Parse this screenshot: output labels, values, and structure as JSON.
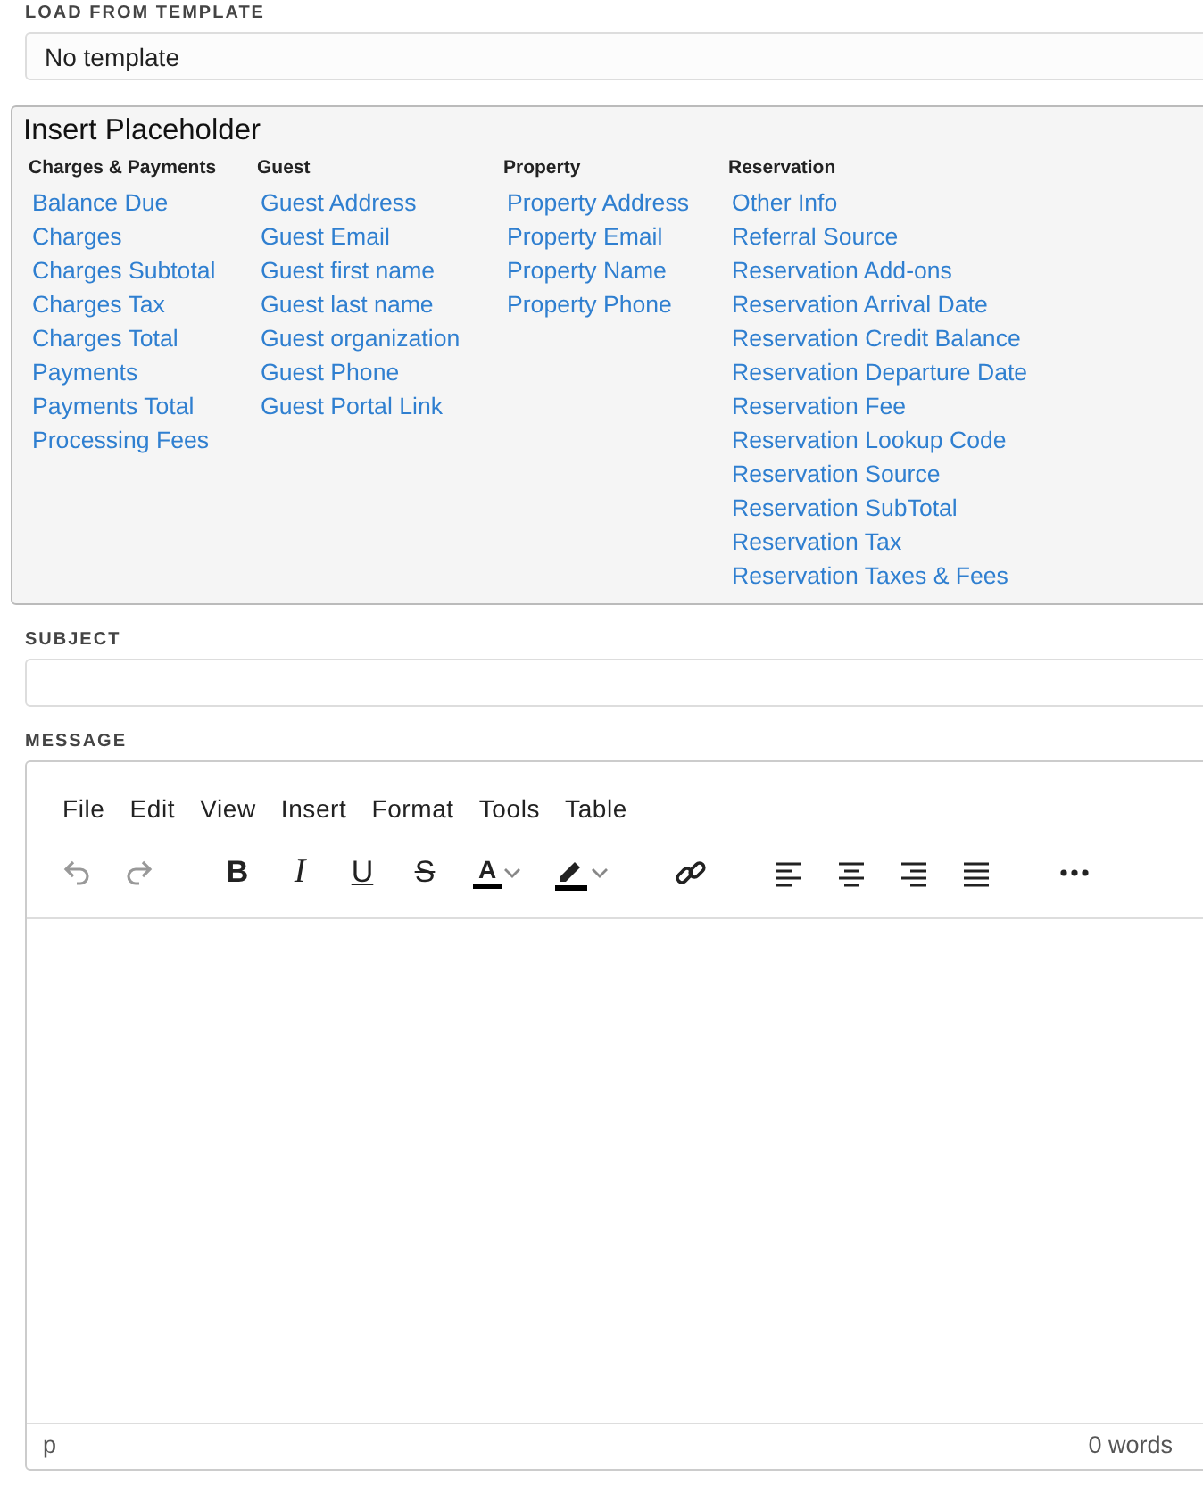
{
  "template": {
    "label": "LOAD FROM TEMPLATE",
    "value": "No template"
  },
  "placeholders": {
    "title": "Insert Placeholder",
    "groups": [
      {
        "heading": "Charges & Payments",
        "items": [
          "Balance Due",
          "Charges",
          "Charges Subtotal",
          "Charges Tax",
          "Charges Total",
          "Payments",
          "Payments Total",
          "Processing Fees"
        ]
      },
      {
        "heading": "Guest",
        "items": [
          "Guest Address",
          "Guest Email",
          "Guest first name",
          "Guest last name",
          "Guest organization",
          "Guest Phone",
          "Guest Portal Link"
        ]
      },
      {
        "heading": "Property",
        "items": [
          "Property Address",
          "Property Email",
          "Property Name",
          "Property Phone"
        ]
      },
      {
        "heading": "Reservation",
        "items": [
          "Other Info",
          "Referral Source",
          "Reservation Add-ons",
          "Reservation Arrival Date",
          "Reservation Credit Balance",
          "Reservation Departure Date",
          "Reservation Fee",
          "Reservation Lookup Code",
          "Reservation Source",
          "Reservation SubTotal",
          "Reservation Tax",
          "Reservation Taxes & Fees"
        ]
      }
    ]
  },
  "subject": {
    "label": "SUBJECT"
  },
  "message": {
    "label": "MESSAGE",
    "menu": [
      "File",
      "Edit",
      "View",
      "Insert",
      "Format",
      "Tools",
      "Table"
    ],
    "toolbar": [
      {
        "kind": "undo",
        "disabled": true
      },
      {
        "kind": "redo",
        "disabled": true
      },
      {
        "kind": "gap"
      },
      {
        "kind": "bold",
        "label": "B"
      },
      {
        "kind": "italic",
        "label": "I"
      },
      {
        "kind": "underline",
        "label": "U"
      },
      {
        "kind": "strike",
        "label": "S"
      },
      {
        "kind": "textcolor",
        "label": "A"
      },
      {
        "kind": "highlight"
      },
      {
        "kind": "gap"
      },
      {
        "kind": "link"
      },
      {
        "kind": "gap"
      },
      {
        "kind": "align-left"
      },
      {
        "kind": "align-center"
      },
      {
        "kind": "align-right"
      },
      {
        "kind": "align-justify"
      },
      {
        "kind": "gap"
      },
      {
        "kind": "more"
      }
    ],
    "path": "p",
    "word_count": "0 words"
  }
}
